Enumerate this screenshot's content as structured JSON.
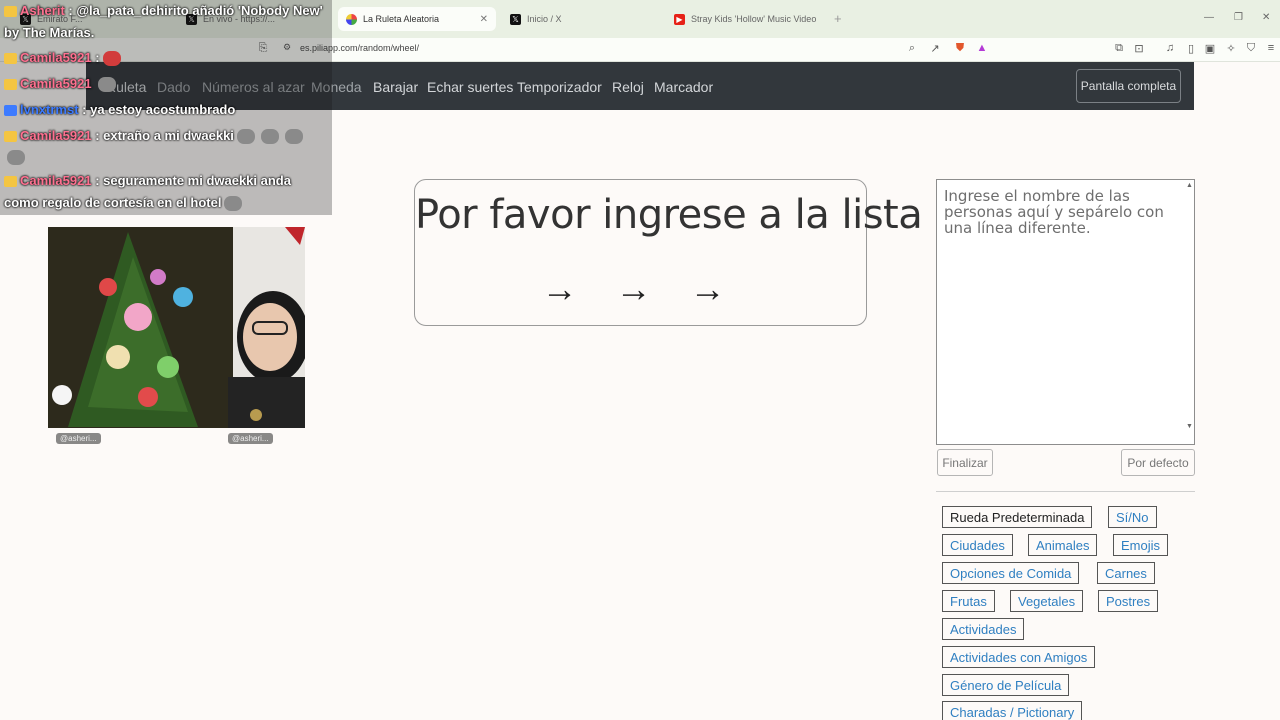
{
  "browser": {
    "tabs": [
      {
        "label": "Emirato F...",
        "icon": "x-logo-icon"
      },
      {
        "label": "En vivo - https://...",
        "icon": "x-logo-icon"
      },
      {
        "label": "La Ruleta Aleatoria",
        "icon": "wheel-icon",
        "active": true
      },
      {
        "label": "Inicio / X",
        "icon": "x-logo-icon"
      },
      {
        "label": "Stray Kids 'Hollow' Music Video",
        "icon": "youtube-icon"
      }
    ],
    "url": "es.piliapp.com/random/wheel/"
  },
  "nav": {
    "items": [
      "Ruleta",
      "Dado",
      "Números al azar",
      "Moneda",
      "Barajar",
      "Echar suertes",
      "Temporizador",
      "Reloj",
      "Marcador"
    ],
    "fullscreen_label": "Pantalla completa"
  },
  "main": {
    "prompt_title": "Por favor ingrese a la lista",
    "prompt_arrows": "→ → →",
    "names_placeholder": "Ingrese el nombre de las personas aquí y sepárelo con una línea diferente.",
    "finish_label": "Finalizar",
    "default_label": "Por defecto",
    "presets": [
      "Rueda Predeterminada",
      "Sí/No",
      "Ciudades",
      "Animales",
      "Emojis",
      "Opciones de Comida",
      "Carnes",
      "Frutas",
      "Vegetales",
      "Postres",
      "Actividades",
      "Actividades con Amigos",
      "Género de Película",
      "Charadas / Pictionary"
    ]
  },
  "chat": [
    {
      "user": "Asherit",
      "text": ": @la_pata_dehirito añadió 'Nobody New'",
      "cont": "by The Marías."
    },
    {
      "user": "Camila5921",
      "text": ":"
    },
    {
      "user": "Camila5921",
      "text": ""
    },
    {
      "user": "lvnxtrmst",
      "text": ": ya estoy acostumbrado"
    },
    {
      "user": "Camila5921",
      "text": ": extraño a mi dwaekki"
    },
    {
      "user": "Camila5921",
      "text": ": seguramente mi dwaekki anda",
      "cont": "como regalo de cortesía en el hotel"
    }
  ],
  "cam": {
    "tag_left": "@asheri...",
    "tag_right": "@asheri..."
  },
  "colors": {
    "navbar": "#32373c",
    "link": "#2f7fc1",
    "page_bg": "#fdfaf8",
    "tabbar": "#e9f0e3"
  }
}
